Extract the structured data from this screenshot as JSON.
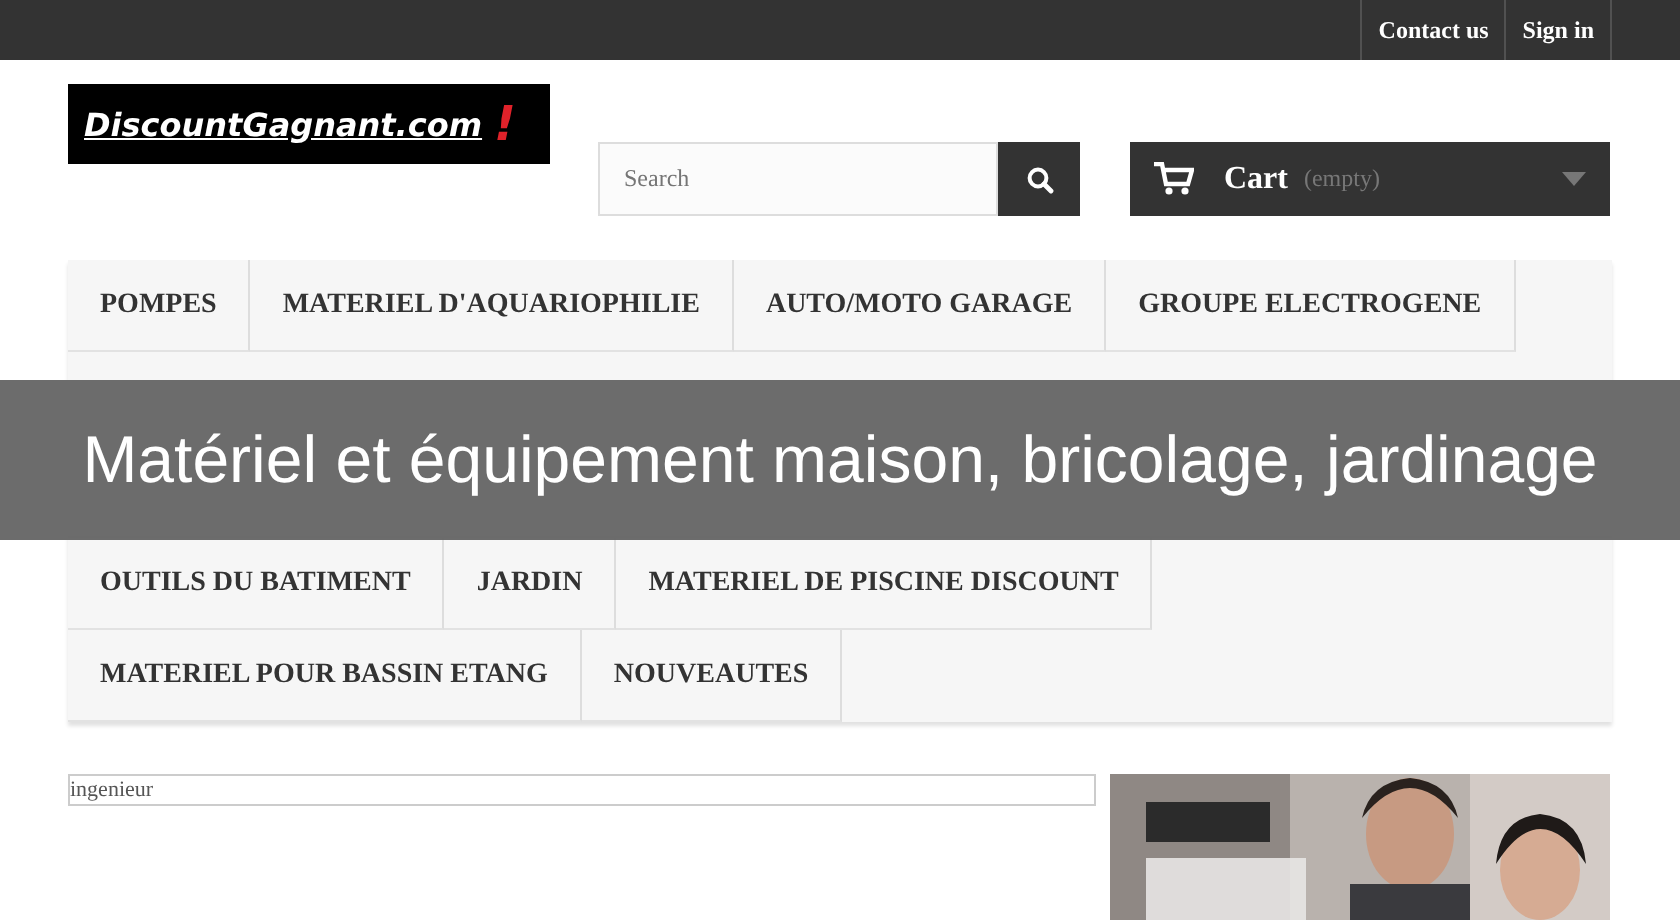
{
  "top_bar": {
    "links": [
      "Contact us",
      "Sign in"
    ]
  },
  "logo": {
    "text": "DiscountGagnant.com",
    "mark": "!"
  },
  "search": {
    "placeholder": "Search"
  },
  "cart": {
    "label": "Cart",
    "status": "(empty)"
  },
  "menu": {
    "top_rows": [
      [
        "POMPES",
        "MATERIEL D'AQUARIOPHILIE",
        "AUTO/MOTO GARAGE",
        "GROUPE ELECTROGENE"
      ]
    ],
    "bottom_rows": [
      [
        "OUTILS DU BATIMENT",
        "JARDIN",
        "MATERIEL DE PISCINE DISCOUNT"
      ],
      [
        "MATERIEL POUR BASSIN ETANG",
        "NOUVEAUTES"
      ]
    ]
  },
  "banner": {
    "text": "Matériel et équipement maison, bricolage, jardinage"
  },
  "content": {
    "field_value": "ingenieur"
  }
}
